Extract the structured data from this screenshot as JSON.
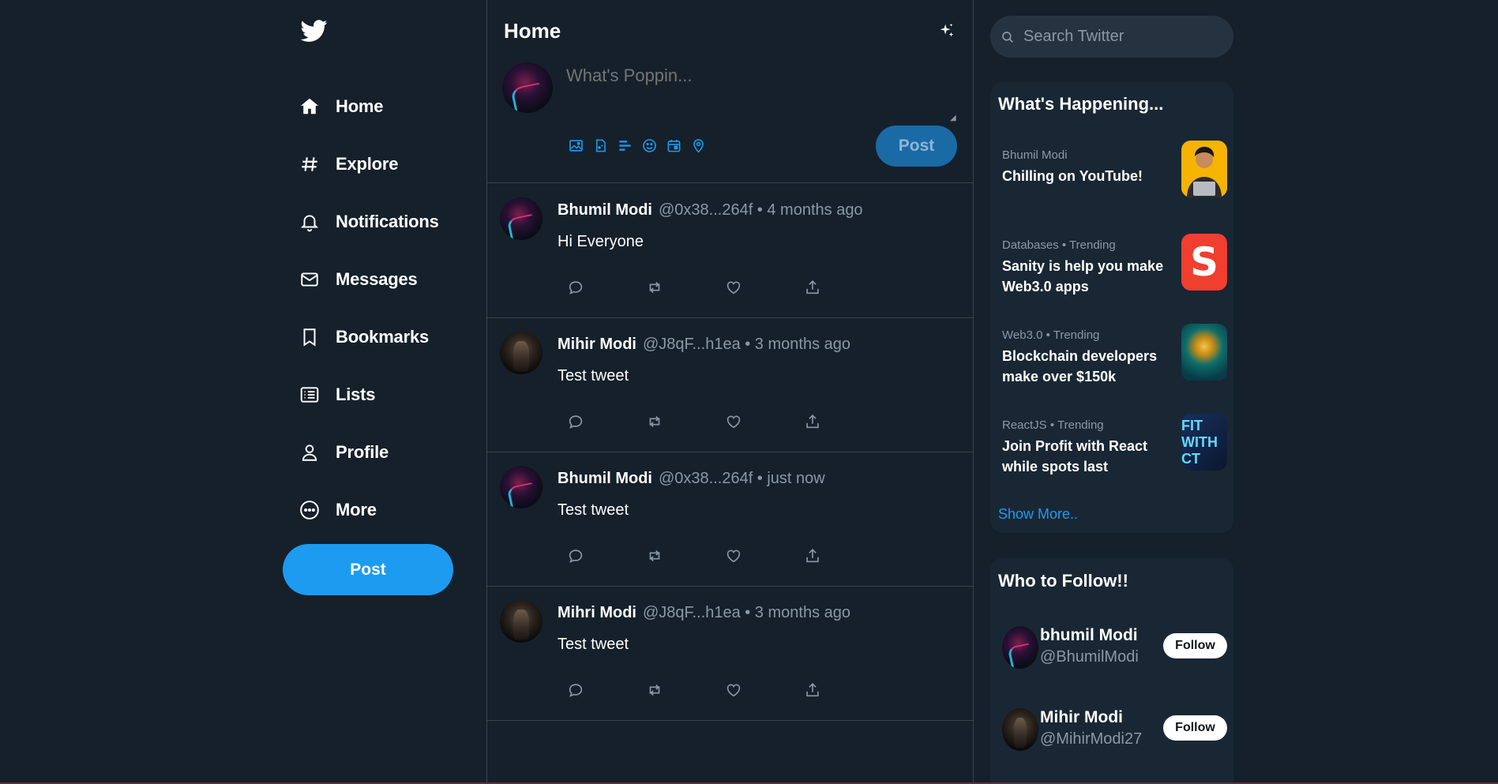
{
  "sidebar": {
    "logo": "twitter-bird-icon",
    "nav": [
      {
        "label": "Home",
        "icon": "home-icon"
      },
      {
        "label": "Explore",
        "icon": "hashtag-icon"
      },
      {
        "label": "Notifications",
        "icon": "bell-icon"
      },
      {
        "label": "Messages",
        "icon": "mail-icon"
      },
      {
        "label": "Bookmarks",
        "icon": "bookmark-icon"
      },
      {
        "label": "Lists",
        "icon": "list-icon"
      },
      {
        "label": "Profile",
        "icon": "person-icon"
      },
      {
        "label": "More",
        "icon": "more-circle-icon"
      }
    ],
    "post_label": "Post"
  },
  "feed": {
    "title": "Home",
    "composer": {
      "placeholder": "What's Poppin...",
      "post_label": "Post",
      "tools": [
        "image-icon",
        "gif-icon",
        "poll-icon",
        "emoji-icon",
        "schedule-icon",
        "location-icon"
      ]
    },
    "tweets": [
      {
        "name": "Bhumil Modi",
        "meta": "@0x38...264f • 4 months ago",
        "text": "Hi Everyone",
        "avatar": "bhumil"
      },
      {
        "name": "Mihir Modi",
        "meta": "@J8qF...h1ea • 3 months ago",
        "text": "Test tweet",
        "avatar": "mihir"
      },
      {
        "name": "Bhumil Modi",
        "meta": "@0x38...264f • just now",
        "text": "Test tweet",
        "avatar": "bhumil"
      },
      {
        "name": "Mihri Modi",
        "meta": "@J8qF...h1ea • 3 months ago",
        "text": "Test tweet",
        "avatar": "mihir"
      }
    ]
  },
  "right": {
    "search_placeholder": "Search Twitter",
    "happening": {
      "title": "What's Happening...",
      "items": [
        {
          "category": "Bhumil Modi",
          "title": "Chilling on YouTube!"
        },
        {
          "category": "Databases • Trending",
          "title": "Sanity is help you make Web3.0 apps",
          "thumb_text": "S"
        },
        {
          "category": "Web3.0 • Trending",
          "title": "Blockchain developers make over $150k"
        },
        {
          "category": "ReactJS • Trending",
          "title": "Join Profit with React while spots last",
          "thumb_text": "FIT WITH CT"
        }
      ],
      "show_more": "Show More.."
    },
    "who_to_follow": {
      "title": "Who to Follow!!",
      "users": [
        {
          "name": "bhumil Modi",
          "handle": "@BhumilModi",
          "button": "Follow"
        },
        {
          "name": "Mihir Modi",
          "handle": "@MihirModi27",
          "button": "Follow"
        }
      ]
    }
  },
  "colors": {
    "background": "#15202b",
    "accent": "#1d9bf0",
    "panel": "#192734",
    "muted_text": "#8b98a5",
    "border": "#38444d"
  }
}
